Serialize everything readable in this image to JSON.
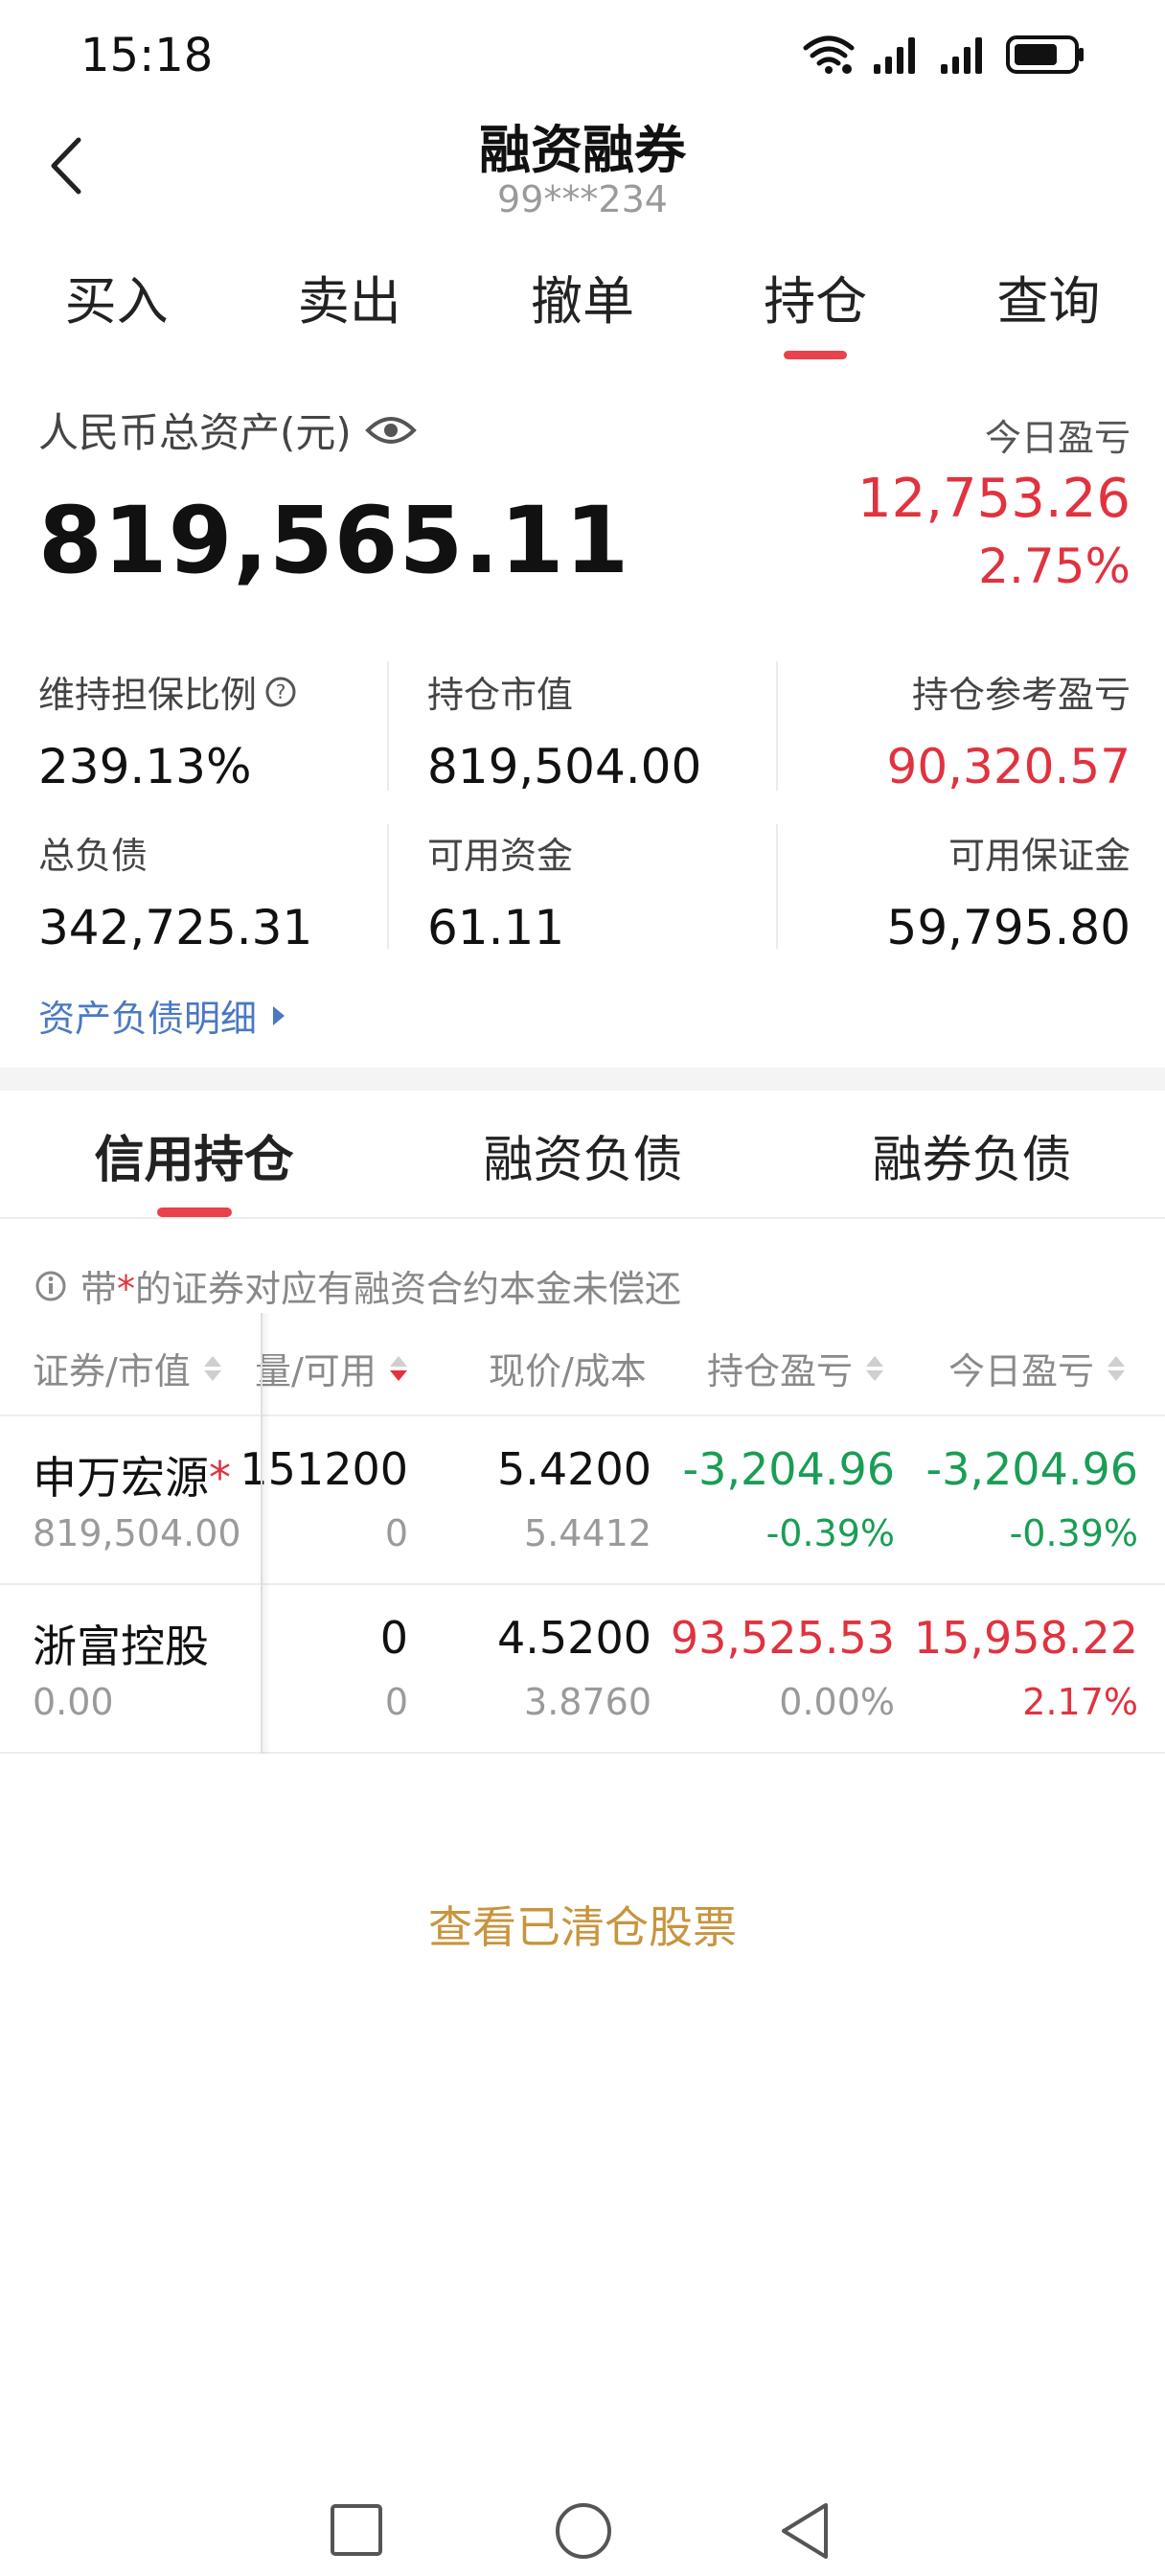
{
  "status_bar": {
    "time": "15:18",
    "icons": [
      "wifi-icon",
      "signal-icon",
      "signal-icon",
      "battery-icon"
    ]
  },
  "header": {
    "title": "融资融券",
    "account": "99***234"
  },
  "tabs": [
    {
      "label": "买入"
    },
    {
      "label": "卖出"
    },
    {
      "label": "撤单"
    },
    {
      "label": "持仓",
      "active": true
    },
    {
      "label": "查询"
    }
  ],
  "summary": {
    "total_asset_label": "人民币总资产(元)",
    "total_asset_value": "819,565.11",
    "today_pl_label": "今日盈亏",
    "today_pl_value": "12,753.26",
    "today_pl_pct": "2.75%"
  },
  "metrics": {
    "maintenance_ratio_label": "维持担保比例",
    "maintenance_ratio_value": "239.13%",
    "position_value_label": "持仓市值",
    "position_value_value": "819,504.00",
    "position_ref_pl_label": "持仓参考盈亏",
    "position_ref_pl_value": "90,320.57",
    "total_liability_label": "总负债",
    "total_liability_value": "342,725.31",
    "available_funds_label": "可用资金",
    "available_funds_value": "61.11",
    "available_margin_label": "可用保证金",
    "available_margin_value": "59,795.80"
  },
  "detail_link": "资产负债明细",
  "subtabs": [
    {
      "label": "信用持仓",
      "active": true
    },
    {
      "label": "融资负债"
    },
    {
      "label": "融券负债"
    }
  ],
  "notice": {
    "prefix": "带",
    "star": "*",
    "text": "的证券对应有融资合约本金未偿还"
  },
  "table": {
    "headers": {
      "security": "证券/市值",
      "quantity": "量/可用",
      "price": "现价/成本",
      "position_pl": "持仓盈亏",
      "today_pl": "今日盈亏"
    },
    "rows": [
      {
        "name": "申万宏源",
        "star": "*",
        "market_value": "819,504.00",
        "quantity": "151200",
        "available": "0",
        "price": "5.4200",
        "cost": "5.4412",
        "position_pl": "-3,204.96",
        "position_pl_pct": "-0.39%",
        "today_pl": "-3,204.96",
        "today_pl_pct": "-0.39%"
      },
      {
        "name": "浙富控股",
        "star": "",
        "market_value": "0.00",
        "quantity": "0",
        "available": "0",
        "price": "4.5200",
        "cost": "3.8760",
        "position_pl": "93,525.53",
        "position_pl_pct": "0.00%",
        "today_pl": "15,958.22",
        "today_pl_pct": "2.17%"
      }
    ]
  },
  "cleared_link": "查看已清仓股票",
  "colors": {
    "up": "#e0333f",
    "down": "#1a9e55",
    "accent": "#e8424d",
    "link": "#4a78c2",
    "gold": "#c8943e"
  }
}
